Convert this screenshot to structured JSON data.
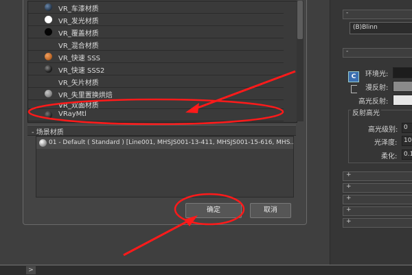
{
  "material_list": [
    {
      "label": "VR_车漆材质",
      "icon": "sphere-dark-blue-icon",
      "color": "#2b3e55"
    },
    {
      "label": "VR_发光材质",
      "icon": "sphere-white-icon",
      "color": "#ffffff"
    },
    {
      "label": "VR_覆盖材质",
      "icon": "sphere-black-icon",
      "color": "#050505"
    },
    {
      "label": "VR_混合材质",
      "icon": "sphere-none-icon",
      "color": "#3a3a3a"
    },
    {
      "label": "VR_快速 SSS",
      "icon": "sphere-orange-icon",
      "color": "#c06a2a"
    },
    {
      "label": "VR_快速 SSS2",
      "icon": "sphere-dark-icon",
      "color": "#222222"
    },
    {
      "label": "VR_矢片材质",
      "icon": "sphere-none-icon",
      "color": "#3a3a3a"
    },
    {
      "label": "VR_失里置换烘焙",
      "icon": "sphere-gray-icon",
      "color": "#8a8a8a"
    },
    {
      "label": "VR_双面材质",
      "icon": "sphere-none-icon",
      "color": "#3a3a3a"
    },
    {
      "label": "VRayMtl",
      "icon": "sphere-dark-icon",
      "color": "#2a2a2a"
    }
  ],
  "scene_materials": {
    "header": "- 场景材质",
    "items": [
      "01 - Default ( Standard ) [Line001, MHSJS001-13-411, MHSJS001-15-616, MHS..."
    ]
  },
  "buttons": {
    "ok": "确定",
    "cancel": "取消"
  },
  "right_panel": {
    "shader_select": "(B)Blinn",
    "rollout_minus": "-",
    "ambient_label": "环境光:",
    "diffuse_label": "漫反射:",
    "specular_label": "高光反射:",
    "specular_highlights_title": "反射高光",
    "specular_level_label": "高光级别:",
    "specular_level_value": "0",
    "glossiness_label": "光泽度:",
    "glossiness_value": "10",
    "soften_label": "柔化:",
    "soften_value": "0.1",
    "expand_glyph": "+",
    "lock_glyph": "C"
  },
  "bottom_bar": {
    "arrow": ">"
  },
  "annotation_color": "#ff1a1a"
}
